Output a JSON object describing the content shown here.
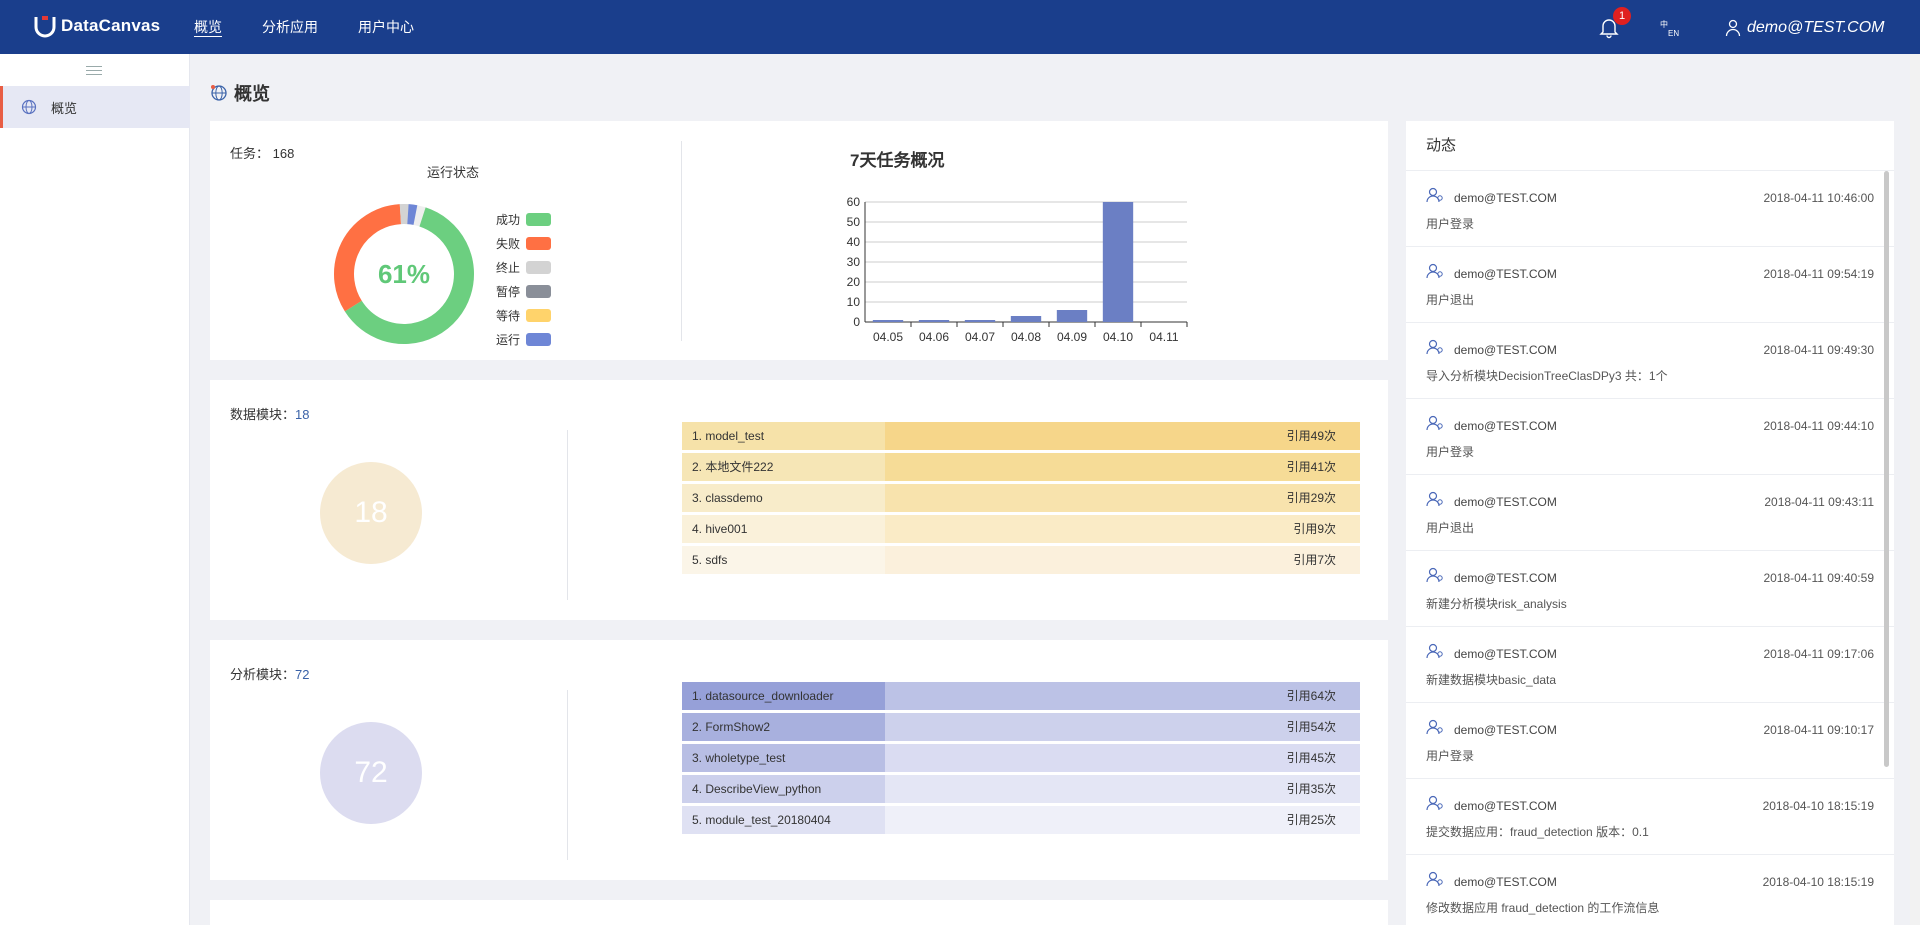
{
  "app": {
    "name": "DataCanvas"
  },
  "nav": {
    "items": [
      "概览",
      "分析应用",
      "用户中心"
    ]
  },
  "header": {
    "notification_count": "1",
    "lang_top": "中",
    "lang_bottom": "EN",
    "user": "demo@TEST.COM"
  },
  "sidebar": {
    "items": [
      {
        "label": "概览",
        "icon": "globe-icon"
      }
    ]
  },
  "page": {
    "title": "概览"
  },
  "tasks": {
    "label": "任务：",
    "count": "168",
    "status_title": "运行状态",
    "percent": "61%",
    "legend": [
      {
        "label": "成功",
        "color": "#6ccf80"
      },
      {
        "label": "失败",
        "color": "#ff7043"
      },
      {
        "label": "终止",
        "color": "#d3d3d3"
      },
      {
        "label": "暂停",
        "color": "#8a8f99"
      },
      {
        "label": "等待",
        "color": "#ffd36b"
      },
      {
        "label": "运行",
        "color": "#6e86d6"
      }
    ]
  },
  "chart_data": {
    "type": "bar",
    "title": "7天任务概况",
    "categories": [
      "04.05",
      "04.06",
      "04.07",
      "04.08",
      "04.09",
      "04.10",
      "04.11"
    ],
    "values": [
      1,
      1,
      1,
      3,
      6,
      60,
      0
    ],
    "ylim": [
      0,
      60
    ],
    "yticks": [
      0,
      10,
      20,
      30,
      40,
      50,
      60
    ],
    "color": "#6b7fc4",
    "grid": true
  },
  "data_modules": {
    "label": "数据模块：",
    "count": "18",
    "circle_value": "18",
    "items": [
      {
        "name": "1. model_test",
        "refs": "引用49次"
      },
      {
        "name": "2. 本地文件222",
        "refs": "引用41次"
      },
      {
        "name": "3. classdemo",
        "refs": "引用29次"
      },
      {
        "name": "4. hive001",
        "refs": "引用9次"
      },
      {
        "name": "5. sdfs",
        "refs": "引用7次"
      }
    ]
  },
  "analysis_modules": {
    "label": "分析模块：",
    "count": "72",
    "circle_value": "72",
    "items": [
      {
        "name": "1. datasource_downloader",
        "refs": "引用64次"
      },
      {
        "name": "2. FormShow2",
        "refs": "引用54次"
      },
      {
        "name": "3. wholetype_test",
        "refs": "引用45次"
      },
      {
        "name": "4. DescribeView_python",
        "refs": "引用35次"
      },
      {
        "name": "5. module_test_20180404",
        "refs": "引用25次"
      }
    ]
  },
  "activity": {
    "title": "动态",
    "items": [
      {
        "user": "demo@TEST.COM",
        "time": "2018-04-11 10:46:00",
        "action": "用户登录"
      },
      {
        "user": "demo@TEST.COM",
        "time": "2018-04-11 09:54:19",
        "action": "用户退出"
      },
      {
        "user": "demo@TEST.COM",
        "time": "2018-04-11 09:49:30",
        "action": "导入分析模块DecisionTreeClasDPy3 共：1个"
      },
      {
        "user": "demo@TEST.COM",
        "time": "2018-04-11 09:44:10",
        "action": "用户登录"
      },
      {
        "user": "demo@TEST.COM",
        "time": "2018-04-11 09:43:11",
        "action": "用户退出"
      },
      {
        "user": "demo@TEST.COM",
        "time": "2018-04-11 09:40:59",
        "action": "新建分析模块risk_analysis"
      },
      {
        "user": "demo@TEST.COM",
        "time": "2018-04-11 09:17:06",
        "action": "新建数据模块basic_data"
      },
      {
        "user": "demo@TEST.COM",
        "time": "2018-04-11 09:10:17",
        "action": "用户登录"
      },
      {
        "user": "demo@TEST.COM",
        "time": "2018-04-10 18:15:19",
        "action": "提交数据应用：fraud_detection 版本：0.1"
      },
      {
        "user": "demo@TEST.COM",
        "time": "2018-04-10 18:15:19",
        "action": "修改数据应用 fraud_detection 的工作流信息"
      }
    ]
  }
}
